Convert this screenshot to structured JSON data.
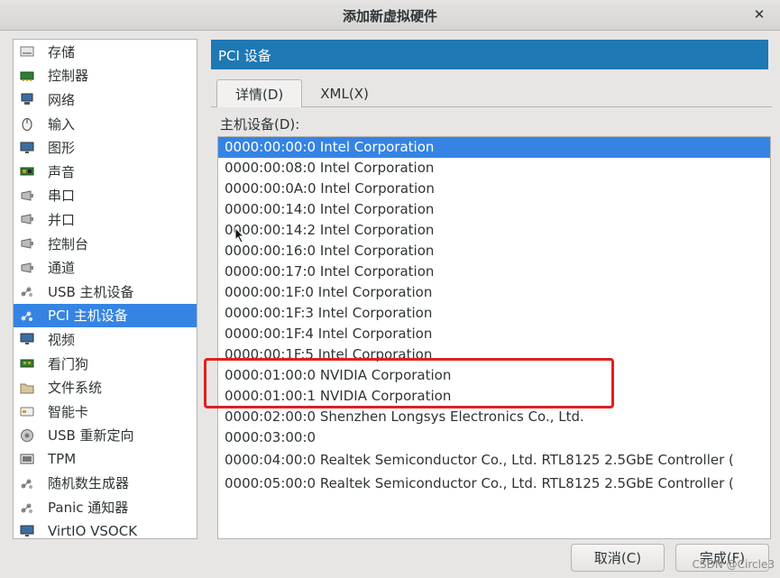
{
  "window": {
    "title": "添加新虚拟硬件",
    "close_label": "✕"
  },
  "sidebar": {
    "items": [
      {
        "label": "存储",
        "icon": "disk-icon"
      },
      {
        "label": "控制器",
        "icon": "controller-icon"
      },
      {
        "label": "网络",
        "icon": "network-icon"
      },
      {
        "label": "输入",
        "icon": "mouse-icon"
      },
      {
        "label": "图形",
        "icon": "monitor-icon"
      },
      {
        "label": "声音",
        "icon": "sound-card-icon"
      },
      {
        "label": "串口",
        "icon": "serial-icon"
      },
      {
        "label": "并口",
        "icon": "parallel-icon"
      },
      {
        "label": "控制台",
        "icon": "console-icon"
      },
      {
        "label": "通道",
        "icon": "channel-icon"
      },
      {
        "label": "USB 主机设备",
        "icon": "usb-icon"
      },
      {
        "label": "PCI 主机设备",
        "icon": "pci-icon",
        "selected": true
      },
      {
        "label": "视频",
        "icon": "video-icon"
      },
      {
        "label": "看门狗",
        "icon": "watchdog-icon"
      },
      {
        "label": "文件系统",
        "icon": "folder-icon"
      },
      {
        "label": "智能卡",
        "icon": "smartcard-icon"
      },
      {
        "label": "USB 重新定向",
        "icon": "usb-redirect-icon"
      },
      {
        "label": "TPM",
        "icon": "tpm-icon"
      },
      {
        "label": "随机数生成器",
        "icon": "rng-icon"
      },
      {
        "label": "Panic 通知器",
        "icon": "panic-icon"
      },
      {
        "label": "VirtIO VSOCK",
        "icon": "vsock-icon"
      }
    ]
  },
  "panel": {
    "header": "PCI 设备",
    "tabs": [
      {
        "label": "详情(D)",
        "active": true
      },
      {
        "label": "XML(X)",
        "active": false
      }
    ],
    "list_label": "主机设备(D):",
    "devices": [
      "0000:00:00:0 Intel Corporation",
      "0000:00:08:0 Intel Corporation",
      "0000:00:0A:0 Intel Corporation",
      "0000:00:14:0 Intel Corporation",
      "0000:00:14:2 Intel Corporation",
      "0000:00:16:0 Intel Corporation",
      "0000:00:17:0 Intel Corporation",
      "0000:00:1F:0 Intel Corporation",
      "0000:00:1F:3 Intel Corporation",
      "0000:00:1F:4 Intel Corporation",
      "0000:00:1F:5 Intel Corporation",
      "0000:01:00:0 NVIDIA Corporation",
      "0000:01:00:1 NVIDIA Corporation",
      "0000:02:00:0 Shenzhen Longsys Electronics Co., Ltd.",
      "0000:03:00:0",
      "0000:04:00:0 Realtek Semiconductor Co., Ltd. RTL8125 2.5GbE Controller (",
      "0000:05:00:0 Realtek Semiconductor Co., Ltd. RTL8125 2.5GbE Controller ("
    ],
    "selected_index": 0
  },
  "buttons": {
    "cancel": "取消(C)",
    "finish": "完成(F)"
  },
  "watermark": "CSDN @Circle3",
  "colors": {
    "selection": "#3584e4",
    "header": "#1e78b4",
    "annotation": "#e02020"
  }
}
